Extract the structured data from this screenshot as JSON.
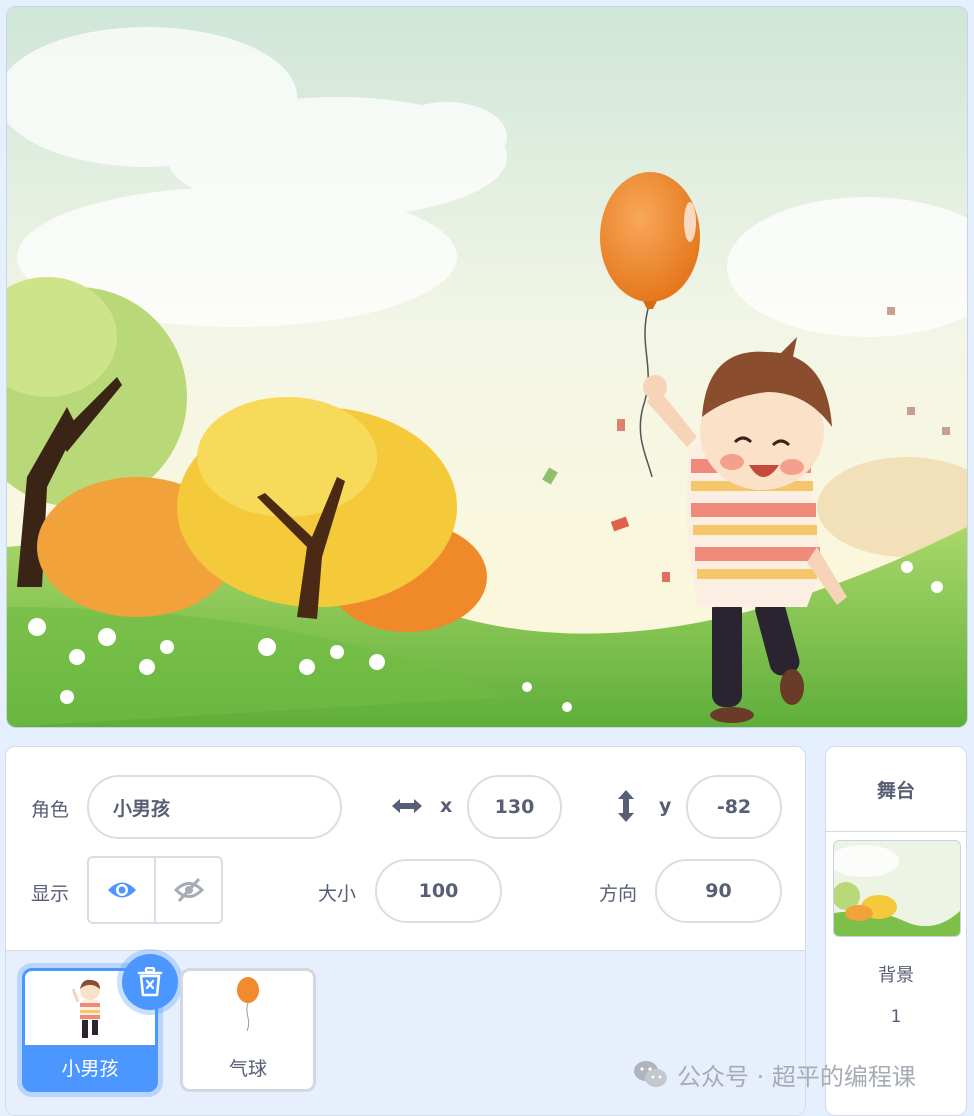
{
  "sprite_info": {
    "sprite_label": "角色",
    "sprite_name": "小男孩",
    "x_label": "x",
    "x_value": "130",
    "y_label": "y",
    "y_value": "-82",
    "show_label": "显示",
    "size_label": "大小",
    "size_value": "100",
    "direction_label": "方向",
    "direction_value": "90"
  },
  "sprites": [
    {
      "name": "小男孩",
      "selected": true
    },
    {
      "name": "气球",
      "selected": false
    }
  ],
  "stage_panel": {
    "title": "舞台",
    "backdrops_label": "背景",
    "backdrops_count": "1"
  },
  "watermark": "公众号 · 超平的编程课",
  "colors": {
    "accent": "#4c97ff",
    "text": "#575e75",
    "panel_bg": "#e5f0ff",
    "balloon": "#f28a2e"
  },
  "icons": [
    "horizontal-arrows-icon",
    "vertical-arrows-icon",
    "eye-icon",
    "eye-off-icon",
    "trash-icon",
    "wechat-icon"
  ]
}
